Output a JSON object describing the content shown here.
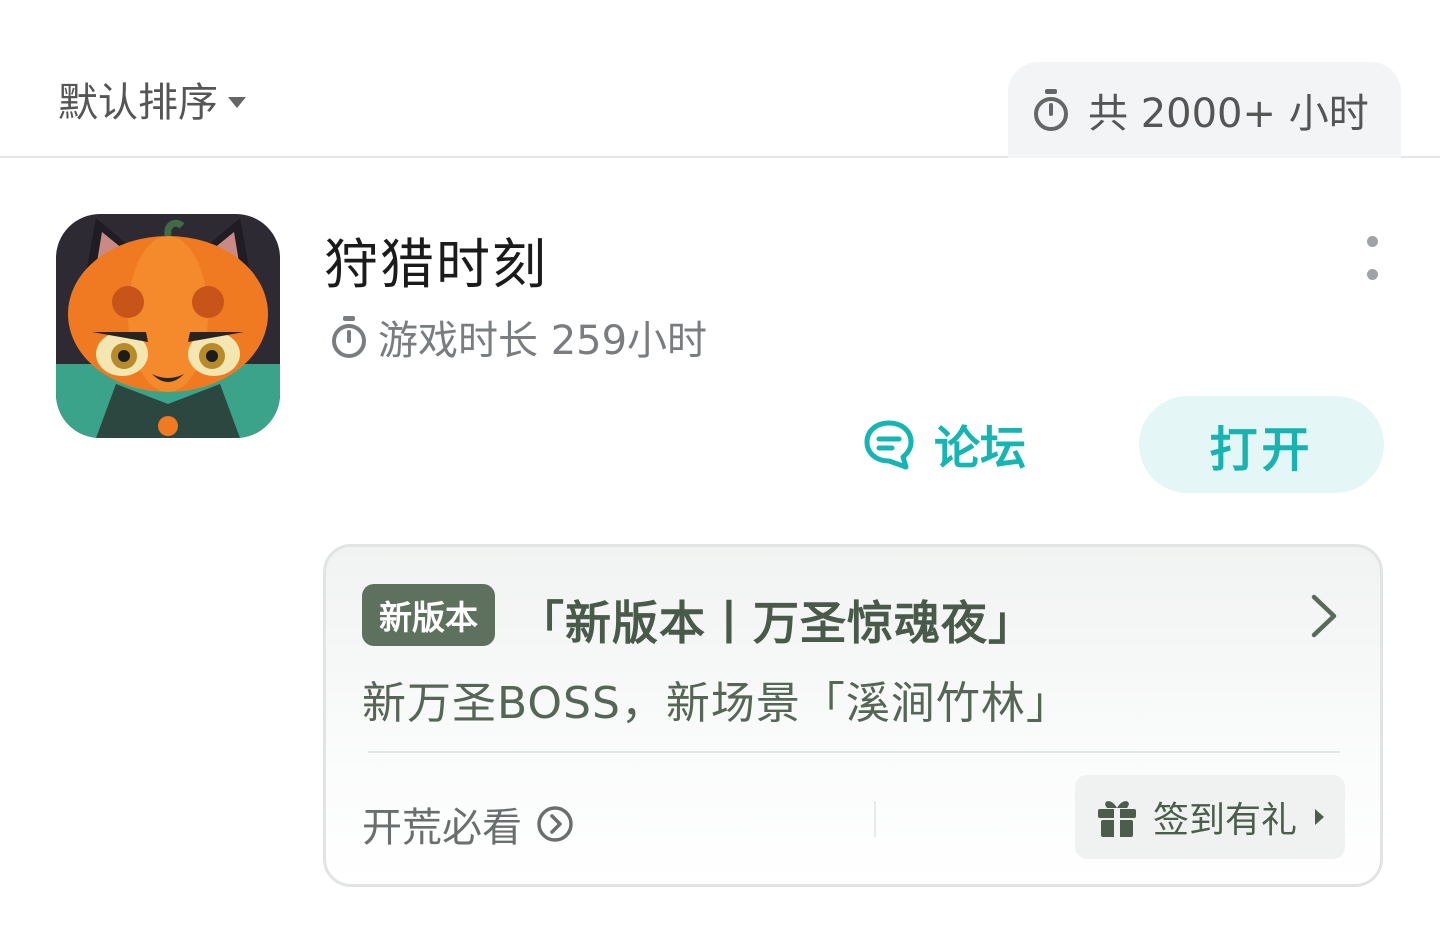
{
  "header": {
    "sort_label": "默认排序",
    "total_hours_label": "共 2000+ 小时"
  },
  "game": {
    "title": "狩猎时刻",
    "playtime_label": "游戏时长 259小时",
    "forum_label": "论坛",
    "open_label": "打开"
  },
  "news": {
    "badge": "新版本",
    "title": "「新版本丨万圣惊魂夜」",
    "subtitle": "新万圣BOSS，新场景「溪涧竹林」",
    "guide_label": "开荒必看",
    "checkin_label": "签到有礼"
  },
  "colors": {
    "accent": "#18b3b1",
    "accent_bg": "#e4f6f6",
    "badge_bg": "#5e715f",
    "news_text": "#4a5a4a"
  },
  "icons": {
    "sort": "chevron-down-icon",
    "total": "stopwatch-icon",
    "playtime": "stopwatch-icon",
    "forum": "chat-bubble-icon",
    "more": "more-vertical-icon",
    "news_arrow": "chevron-right-icon",
    "guide": "circle-chevron-right-icon",
    "checkin": "gift-icon"
  }
}
